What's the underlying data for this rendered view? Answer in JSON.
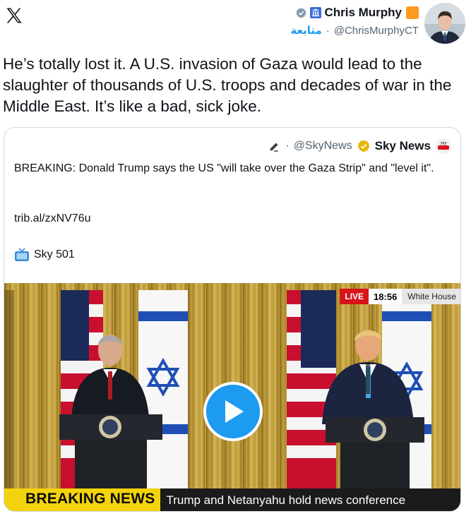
{
  "app": {
    "logo": "x-logo"
  },
  "author": {
    "name": "Chris Murphy",
    "follow_label": "متابعة",
    "handle": "@ChrisMurphyCT",
    "badges": [
      "gray-verified-icon",
      "government-icon",
      "orange-square-icon"
    ]
  },
  "tweet": {
    "text": "He’s totally lost it. A U.S. invasion of Gaza would lead to the slaughter of thousands of U.S. troops and decades of war in the Middle East. It’s like a bad, sick joke."
  },
  "quoted": {
    "handle": "@SkyNews",
    "name": "Sky News",
    "logo_text": "sky news",
    "text": "BREAKING: Donald Trump says the US \"will take over the Gaza Strip\" and \"level it\".",
    "link": "trib.al/zxNV76u",
    "tv_label": "Sky 501"
  },
  "video": {
    "live_label": "LIVE",
    "time": "18:56",
    "location": "White House",
    "breaking_label": "BREAKING NEWS",
    "ticker_text": "Trump and Netanyahu hold news conference"
  },
  "colors": {
    "accent": "#1d9bf0",
    "breaking_yellow": "#f3d30b",
    "live_red": "#d7141a"
  }
}
